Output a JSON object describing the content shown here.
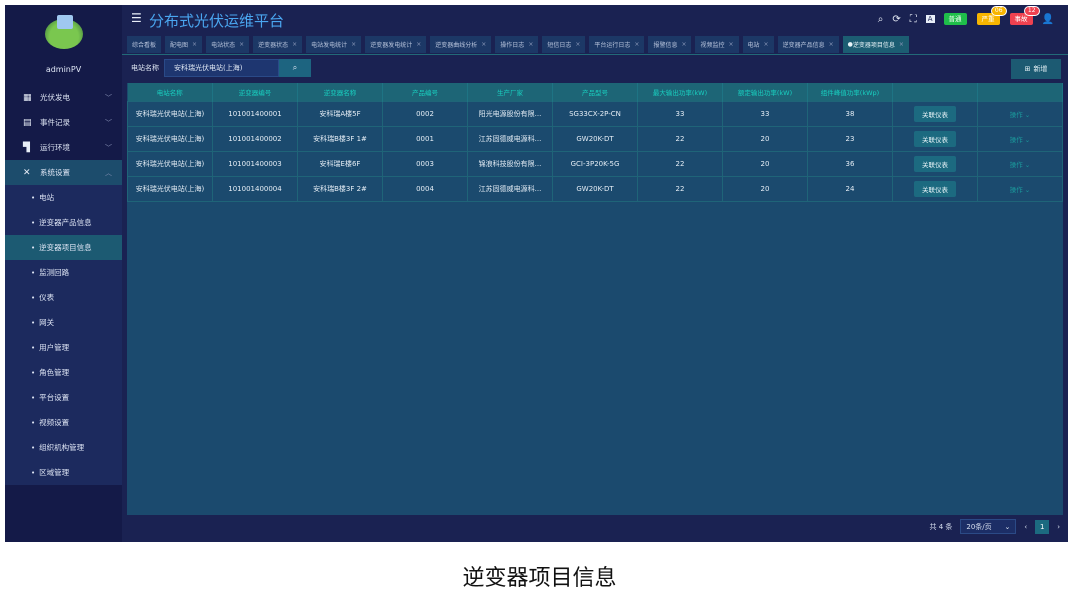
{
  "app": {
    "title": "分布式光伏运维平台",
    "user": "adminPV"
  },
  "header": {
    "badges": [
      {
        "label": "普通",
        "color": "#1fbf4a"
      },
      {
        "label": "严重",
        "color": "#f7b500",
        "count": "06"
      },
      {
        "label": "事故",
        "color": "#ef4150",
        "count": "12"
      }
    ]
  },
  "tabs": [
    {
      "label": "综合看板",
      "closable": false
    },
    {
      "label": "配电图"
    },
    {
      "label": "电站状态"
    },
    {
      "label": "逆变器状态"
    },
    {
      "label": "电站发电统计"
    },
    {
      "label": "逆变器发电统计"
    },
    {
      "label": "逆变器曲线分析"
    },
    {
      "label": "操作日志"
    },
    {
      "label": "短信日志"
    },
    {
      "label": "平台运行日志"
    },
    {
      "label": "报警信息"
    },
    {
      "label": "视频监控"
    },
    {
      "label": "电站"
    },
    {
      "label": "逆变器产品信息"
    },
    {
      "label": "逆变器项目信息",
      "active": true
    }
  ],
  "sidebar": {
    "menus": [
      {
        "label": "光伏发电",
        "icon": "grid-icon"
      },
      {
        "label": "事件记录",
        "icon": "document-icon"
      },
      {
        "label": "运行环境",
        "icon": "camera-icon"
      },
      {
        "label": "系统设置",
        "icon": "tools-icon",
        "open": true
      }
    ],
    "subs": [
      "电站",
      "逆变器产品信息",
      "逆变器项目信息",
      "监测回路",
      "仪表",
      "网关",
      "用户管理",
      "角色管理",
      "平台设置",
      "视频设置",
      "组织机构管理",
      "区域管理"
    ],
    "active_sub": "逆变器项目信息"
  },
  "filter": {
    "label": "电站名称",
    "value": "安科瑞光伏电站(上海)",
    "add_label": "新增"
  },
  "table": {
    "columns": [
      "电站名称",
      "逆变器编号",
      "逆变器名称",
      "产品编号",
      "生产厂家",
      "产品型号",
      "最大输出功率(kW)",
      "额定输出功率(kW)",
      "组件峰值功率(kWp)",
      "",
      ""
    ],
    "rows": [
      [
        "安科瑞光伏电站(上海)",
        "101001400001",
        "安科瑞A楼5F",
        "0002",
        "阳光电源股份有限...",
        "SG33CX-2P-CN",
        "33",
        "33",
        "38"
      ],
      [
        "安科瑞光伏电站(上海)",
        "101001400002",
        "安科瑞B楼3F 1#",
        "0001",
        "江苏固德威电源科...",
        "GW20K-DT",
        "22",
        "20",
        "23"
      ],
      [
        "安科瑞光伏电站(上海)",
        "101001400003",
        "安科瑞E楼6F",
        "0003",
        "锦浪科技股份有限...",
        "GCI-3P20K-5G",
        "22",
        "20",
        "36"
      ],
      [
        "安科瑞光伏电站(上海)",
        "101001400004",
        "安科瑞B楼3F 2#",
        "0004",
        "江苏固德威电源科...",
        "GW20K-DT",
        "22",
        "20",
        "24"
      ]
    ],
    "row_button": "关联仪表",
    "row_menu": "操作"
  },
  "pager": {
    "total": "共 4 条",
    "page_size": "20条/页",
    "current": "1"
  },
  "caption": "逆变器项目信息"
}
